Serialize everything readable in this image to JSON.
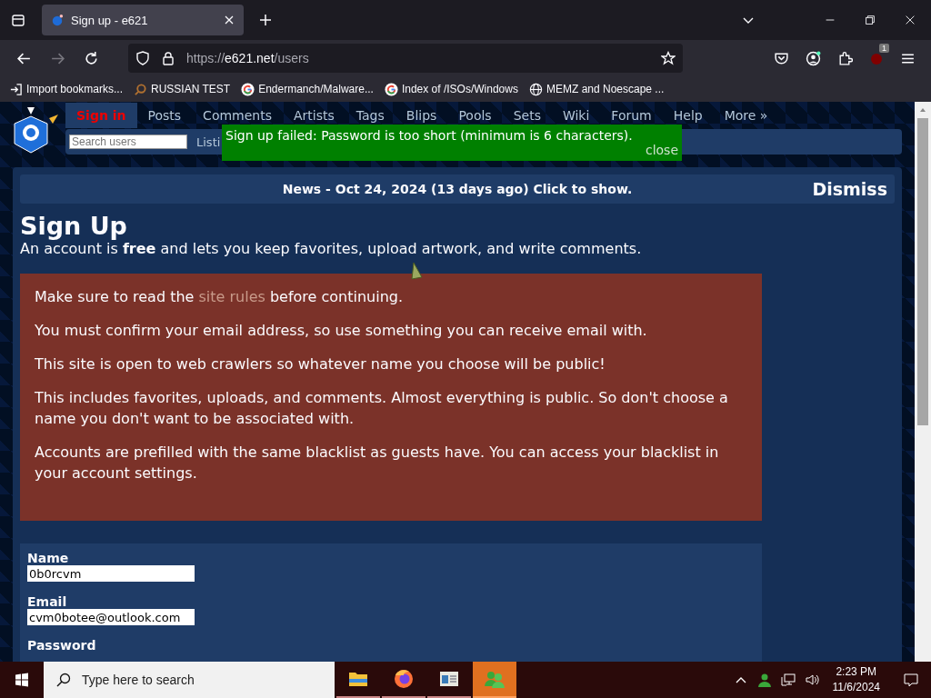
{
  "browser": {
    "tabs": [
      {
        "title": "Sign up - e621",
        "selected": true
      }
    ],
    "url": {
      "prefix": "https://",
      "host": "e621.net",
      "path": "/users"
    },
    "bookmarks": [
      {
        "label": "Import bookmarks...",
        "kind": "import"
      },
      {
        "label": "RUSSIAN TEST",
        "kind": "search"
      },
      {
        "label": "Endermanch/Malware...",
        "kind": "google"
      },
      {
        "label": "Index of /ISOs/Windows",
        "kind": "google"
      },
      {
        "label": "MEMZ and Noescape ...",
        "kind": "globe"
      }
    ],
    "extension_badge": "1"
  },
  "site": {
    "nav": [
      {
        "label": "Sign in",
        "selected": true
      },
      {
        "label": "Posts",
        "selected": false
      },
      {
        "label": "Comments",
        "selected": false
      },
      {
        "label": "Artists",
        "selected": false
      },
      {
        "label": "Tags",
        "selected": false
      },
      {
        "label": "Blips",
        "selected": false
      },
      {
        "label": "Pools",
        "selected": false
      },
      {
        "label": "Sets",
        "selected": false
      },
      {
        "label": "Wiki",
        "selected": false
      },
      {
        "label": "Forum",
        "selected": false
      },
      {
        "label": "Help",
        "selected": false
      },
      {
        "label": "More »",
        "selected": false
      }
    ],
    "search": {
      "placeholder": "Search users"
    },
    "subnav": [
      "Listi"
    ],
    "notice": {
      "message": "Sign up failed: Password is too short (minimum is 6 characters).",
      "close": "close"
    },
    "news": {
      "text": "News - Oct 24, 2024 (13 days ago) Click to show.",
      "dismiss": "Dismiss"
    },
    "title": "Sign Up",
    "intro": "An account is **free** and lets you keep favorites, upload artwork, and write comments.",
    "rules": [
      {
        "before": "Make sure to read the ",
        "link": "site rules",
        "after": " before continuing."
      },
      {
        "before": "You must confirm your email address, so use something you can receive email with."
      },
      {
        "before": "This site is open to web crawlers so whatever name you choose will be public!"
      },
      {
        "before": "This includes favorites, uploads, and comments. Almost everything is public. So don't choose a name you don't want to be associated with."
      },
      {
        "before": "Accounts are prefilled with the same blacklist as guests have. You can access your blacklist in your account settings."
      }
    ],
    "fields": [
      {
        "label": "Name",
        "value": "0b0rcvm"
      },
      {
        "label": "Email",
        "value": "cvm0botee@outlook.com"
      },
      {
        "label": "Password"
      }
    ]
  },
  "taskbar": {
    "search": {
      "placeholder": "Type here to search"
    },
    "apps": [
      {
        "kind": "folder",
        "active": false
      },
      {
        "kind": "firefox",
        "active": false
      },
      {
        "kind": "window",
        "active": false
      },
      {
        "kind": "people",
        "active": true
      }
    ],
    "time": "2:23 PM",
    "date": "11/6/2024"
  }
}
